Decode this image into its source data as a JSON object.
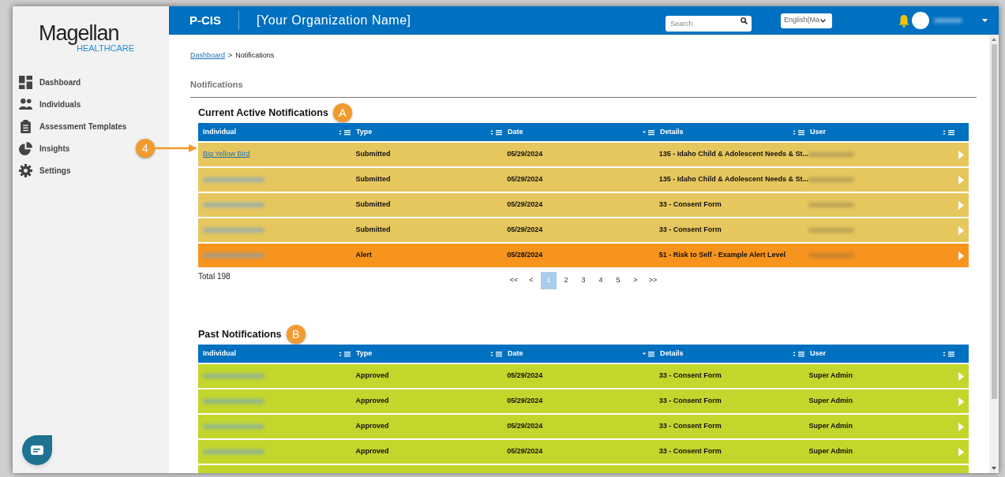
{
  "app": {
    "name": "P-CIS",
    "organization": "[Your Organization Name]"
  },
  "logo": {
    "name": "Magellan",
    "tagline": "HEALTHCARE"
  },
  "header": {
    "search": {
      "placeholder": "Search"
    },
    "language": {
      "value": "English(Ma"
    }
  },
  "sidebar": {
    "items": [
      {
        "label": "Dashboard"
      },
      {
        "label": "Individuals"
      },
      {
        "label": "Assessment Templates"
      },
      {
        "label": "Insights"
      },
      {
        "label": "Settings"
      }
    ]
  },
  "breadcrumb": {
    "link": "Dashboard",
    "separator": ">",
    "current": "Notifications"
  },
  "page_title": "Notifications",
  "sections": [
    {
      "title": "Current Active Notifications",
      "marker": "A",
      "columns": [
        {
          "label": "Individual",
          "sorted": false
        },
        {
          "label": "Type",
          "sorted": false
        },
        {
          "label": "Date",
          "sorted": true
        },
        {
          "label": "Details",
          "sorted": false
        },
        {
          "label": "User",
          "sorted": false
        }
      ],
      "rows": [
        {
          "kind": "submitted",
          "individual": "Big Yellow Bird",
          "type": "Submitted",
          "date": "05/29/2024",
          "details": "135 - Idaho Child & Adolescent Needs & St..."
        },
        {
          "kind": "submitted",
          "type": "Submitted",
          "date": "05/29/2024",
          "details": "135 - Idaho Child & Adolescent Needs & St..."
        },
        {
          "kind": "submitted",
          "type": "Submitted",
          "date": "05/29/2024",
          "details": "33 - Consent Form"
        },
        {
          "kind": "submitted",
          "type": "Submitted",
          "date": "05/29/2024",
          "details": "33 - Consent Form"
        },
        {
          "kind": "alert",
          "type": "Alert",
          "date": "05/28/2024",
          "details": "51 - Risk to Self - Example Alert Level"
        }
      ],
      "total": "Total 198",
      "pagination": [
        {
          "label": "<<",
          "selected": false
        },
        {
          "label": "<",
          "selected": false
        },
        {
          "label": "1",
          "selected": true
        },
        {
          "label": "2",
          "selected": false
        },
        {
          "label": "3",
          "selected": false
        },
        {
          "label": "4",
          "selected": false
        },
        {
          "label": "5",
          "selected": false
        },
        {
          "label": ">",
          "selected": false
        },
        {
          "label": ">>",
          "selected": false
        }
      ]
    },
    {
      "title": "Past Notifications",
      "marker": "B",
      "columns": [
        {
          "label": "Individual",
          "sorted": false
        },
        {
          "label": "Type",
          "sorted": false
        },
        {
          "label": "Date",
          "sorted": true
        },
        {
          "label": "Details",
          "sorted": false
        },
        {
          "label": "User",
          "sorted": false
        }
      ],
      "rows": [
        {
          "kind": "approved",
          "type": "Approved",
          "date": "05/29/2024",
          "details": "33 - Consent Form",
          "user": "Super Admin"
        },
        {
          "kind": "approved",
          "type": "Approved",
          "date": "05/29/2024",
          "details": "33 - Consent Form",
          "user": "Super Admin"
        },
        {
          "kind": "approved",
          "type": "Approved",
          "date": "05/29/2024",
          "details": "33 - Consent Form",
          "user": "Super Admin"
        },
        {
          "kind": "approved",
          "type": "Approved",
          "date": "05/29/2024",
          "details": "33 - Consent Form",
          "user": "Super Admin"
        }
      ]
    }
  ],
  "callout": {
    "label": "4"
  }
}
